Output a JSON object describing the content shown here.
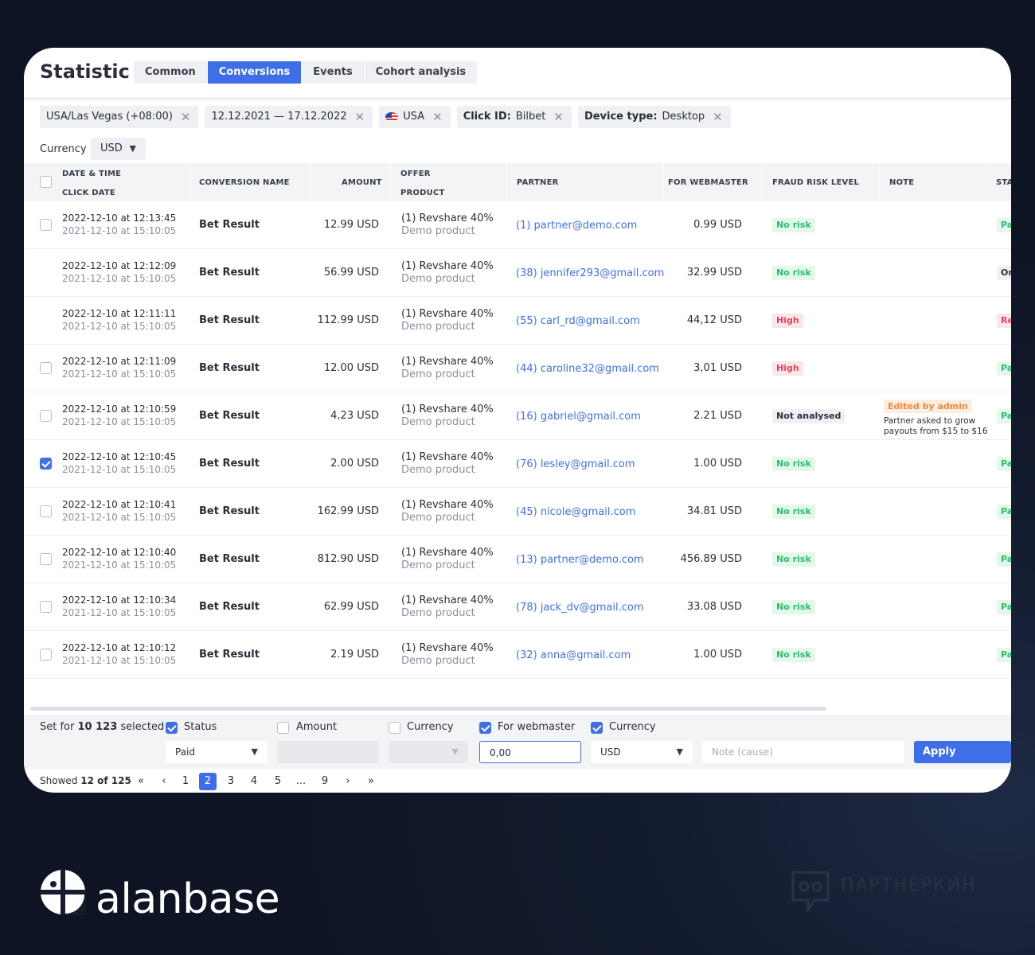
{
  "header": {
    "title": "Statistic",
    "tabs": [
      "Common",
      "Conversions",
      "Events",
      "Cohort analysis"
    ],
    "active_tab": "Conversions"
  },
  "filters": [
    {
      "label": "",
      "value": "USA/Las Vegas (+08:00)"
    },
    {
      "label": "",
      "value": "12.12.2021 — 17.12.2022"
    },
    {
      "label": "",
      "value": "USA",
      "icon": "us-flag-icon"
    },
    {
      "label": "Click ID:",
      "value": "Bilbet"
    },
    {
      "label": "Device type:",
      "value": "Desktop"
    }
  ],
  "currency": {
    "label": "Currency",
    "value": "USD"
  },
  "columns": {
    "date_time": "DATE & TIME",
    "click_date": "CLICK DATE",
    "conversion_name": "CONVERSION NAME",
    "amount": "AMOUNT",
    "offer": "OFFER",
    "product": "PRODUCT",
    "partner": "PARTNER",
    "for_webmaster": "FOR WEBMASTER",
    "fraud_risk_level": "FRAUD RISK LEVEL",
    "note": "NOTE",
    "status": "STA"
  },
  "rows": [
    {
      "checkbox": "empty",
      "date": "2022-12-10 at 12:13:45",
      "click_date": "2021-12-10 at 15:10:05",
      "name": "Bet Result",
      "amount": "12.99 USD",
      "offer": "(1) Revshare 40%",
      "product": "Demo product",
      "partner": "(1) partner@demo.com",
      "webmaster": "0.99 USD",
      "risk": "No risk",
      "risk_kind": "norisk",
      "status": "Paid",
      "status_kind": "paid",
      "note_badge": "",
      "note": ""
    },
    {
      "checkbox": "none",
      "date": "2022-12-10 at 12:12:09",
      "click_date": "2021-12-10 at 15:10:05",
      "name": "Bet Result",
      "amount": "56.99 USD",
      "offer": "(1) Revshare 40%",
      "product": "Demo product",
      "partner": "(38) jennifer293@gmail.com",
      "webmaster": "32.99 USD",
      "risk": "No risk",
      "risk_kind": "norisk",
      "status": "On",
      "status_kind": "other",
      "note_badge": "",
      "note": ""
    },
    {
      "checkbox": "none",
      "date": "2022-12-10 at 12:11:11",
      "click_date": "2021-12-10 at 15:10:05",
      "name": "Bet Result",
      "amount": "112.99 USD",
      "offer": "(1) Revshare 40%",
      "product": "Demo product",
      "partner": "(55) carl_rd@gmail.com",
      "webmaster": "44,12 USD",
      "risk": "High",
      "risk_kind": "high",
      "status": "Re",
      "status_kind": "rej",
      "note_badge": "",
      "note": ""
    },
    {
      "checkbox": "empty",
      "date": "2022-12-10 at 12:11:09",
      "click_date": "2021-12-10 at 15:10:05",
      "name": "Bet Result",
      "amount": "12.00 USD",
      "offer": "(1) Revshare 40%",
      "product": "Demo product",
      "partner": "(44) caroline32@gmail.com",
      "webmaster": "3,01 USD",
      "risk": "High",
      "risk_kind": "high",
      "status": "Paid",
      "status_kind": "paid",
      "note_badge": "",
      "note": ""
    },
    {
      "checkbox": "empty",
      "date": "2022-12-10 at 12:10:59",
      "click_date": "2021-12-10 at 15:10:05",
      "name": "Bet Result",
      "amount": "4,23 USD",
      "offer": "(1) Revshare 40%",
      "product": "Demo product",
      "partner": "(16) gabriel@gmail.com",
      "webmaster": "2.21 USD",
      "risk": "Not analysed",
      "risk_kind": "na",
      "status": "Paid",
      "status_kind": "paid",
      "note_badge": "Edited by admin",
      "note": "Partner asked to grow payouts from $15 to $16"
    },
    {
      "checkbox": "checked",
      "date": "2022-12-10 at 12:10:45",
      "click_date": "2021-12-10 at 15:10:05",
      "name": "Bet Result",
      "amount": "2.00 USD",
      "offer": "(1) Revshare 40%",
      "product": "Demo product",
      "partner": "(76) lesley@gmail.com",
      "webmaster": "1.00 USD",
      "risk": "No risk",
      "risk_kind": "norisk",
      "status": "Paid",
      "status_kind": "paid",
      "note_badge": "",
      "note": ""
    },
    {
      "checkbox": "empty",
      "date": "2022-12-10 at 12:10:41",
      "click_date": "2021-12-10 at 15:10:05",
      "name": "Bet Result",
      "amount": "162.99 USD",
      "offer": "(1) Revshare 40%",
      "product": "Demo product",
      "partner": "(45) nicole@gmail.com",
      "webmaster": "34.81 USD",
      "risk": "No risk",
      "risk_kind": "norisk",
      "status": "Paid",
      "status_kind": "paid",
      "note_badge": "",
      "note": ""
    },
    {
      "checkbox": "empty",
      "date": "2022-12-10 at 12:10:40",
      "click_date": "2021-12-10 at 15:10:05",
      "name": "Bet Result",
      "amount": "812.90 USD",
      "offer": "(1) Revshare 40%",
      "product": "Demo product",
      "partner": "(13) partner@demo.com",
      "webmaster": "456.89 USD",
      "risk": "No risk",
      "risk_kind": "norisk",
      "status": "Paid",
      "status_kind": "paid",
      "note_badge": "",
      "note": ""
    },
    {
      "checkbox": "empty",
      "date": "2022-12-10 at 12:10:34",
      "click_date": "2021-12-10 at 15:10:05",
      "name": "Bet Result",
      "amount": "62.99 USD",
      "offer": "(1) Revshare 40%",
      "product": "Demo product",
      "partner": "(78) jack_dv@gmail.com",
      "webmaster": "33.08 USD",
      "risk": "No risk",
      "risk_kind": "norisk",
      "status": "Paid",
      "status_kind": "paid",
      "note_badge": "",
      "note": ""
    },
    {
      "checkbox": "empty",
      "date": "2022-12-10 at 12:10:12",
      "click_date": "2021-12-10 at 15:10:05",
      "name": "Bet Result",
      "amount": "2.19 USD",
      "offer": "(1) Revshare 40%",
      "product": "Demo product",
      "partner": "(32) anna@gmail.com",
      "webmaster": "1.00 USD",
      "risk": "No risk",
      "risk_kind": "norisk",
      "status": "Paid",
      "status_kind": "paid",
      "note_badge": "",
      "note": ""
    }
  ],
  "bulk": {
    "set_for_prefix": "Set for ",
    "set_for_count": "10 123",
    "set_for_suffix": " selected",
    "fields": [
      {
        "label": "Status",
        "checked": true,
        "value": "Paid",
        "type": "select"
      },
      {
        "label": "Amount",
        "checked": false,
        "value": "",
        "type": "input"
      },
      {
        "label": "Currency",
        "checked": false,
        "value": "",
        "type": "select"
      },
      {
        "label": "For webmaster",
        "checked": true,
        "value": "0,00",
        "type": "input"
      },
      {
        "label": "Currency",
        "checked": true,
        "value": "USD",
        "type": "select"
      }
    ],
    "note_placeholder": "Note (cause)",
    "apply_label": "Apply changes"
  },
  "pagination": {
    "showed_label": "Showed",
    "showed_value": "12 of 125",
    "pages": [
      "1",
      "2",
      "3",
      "4",
      "5",
      "...",
      "9"
    ],
    "current": "2",
    "first": "«",
    "prev": "‹",
    "next": "›",
    "last": "»"
  },
  "brand": {
    "name": "alanbase",
    "watermark": "ПАРТНЕРКИН"
  },
  "colors": {
    "accent": "#3f6fe8",
    "background": "#141c30",
    "no_risk": "#2bbf6a",
    "high": "#e2465c",
    "note_badge": "#f08a3c"
  }
}
